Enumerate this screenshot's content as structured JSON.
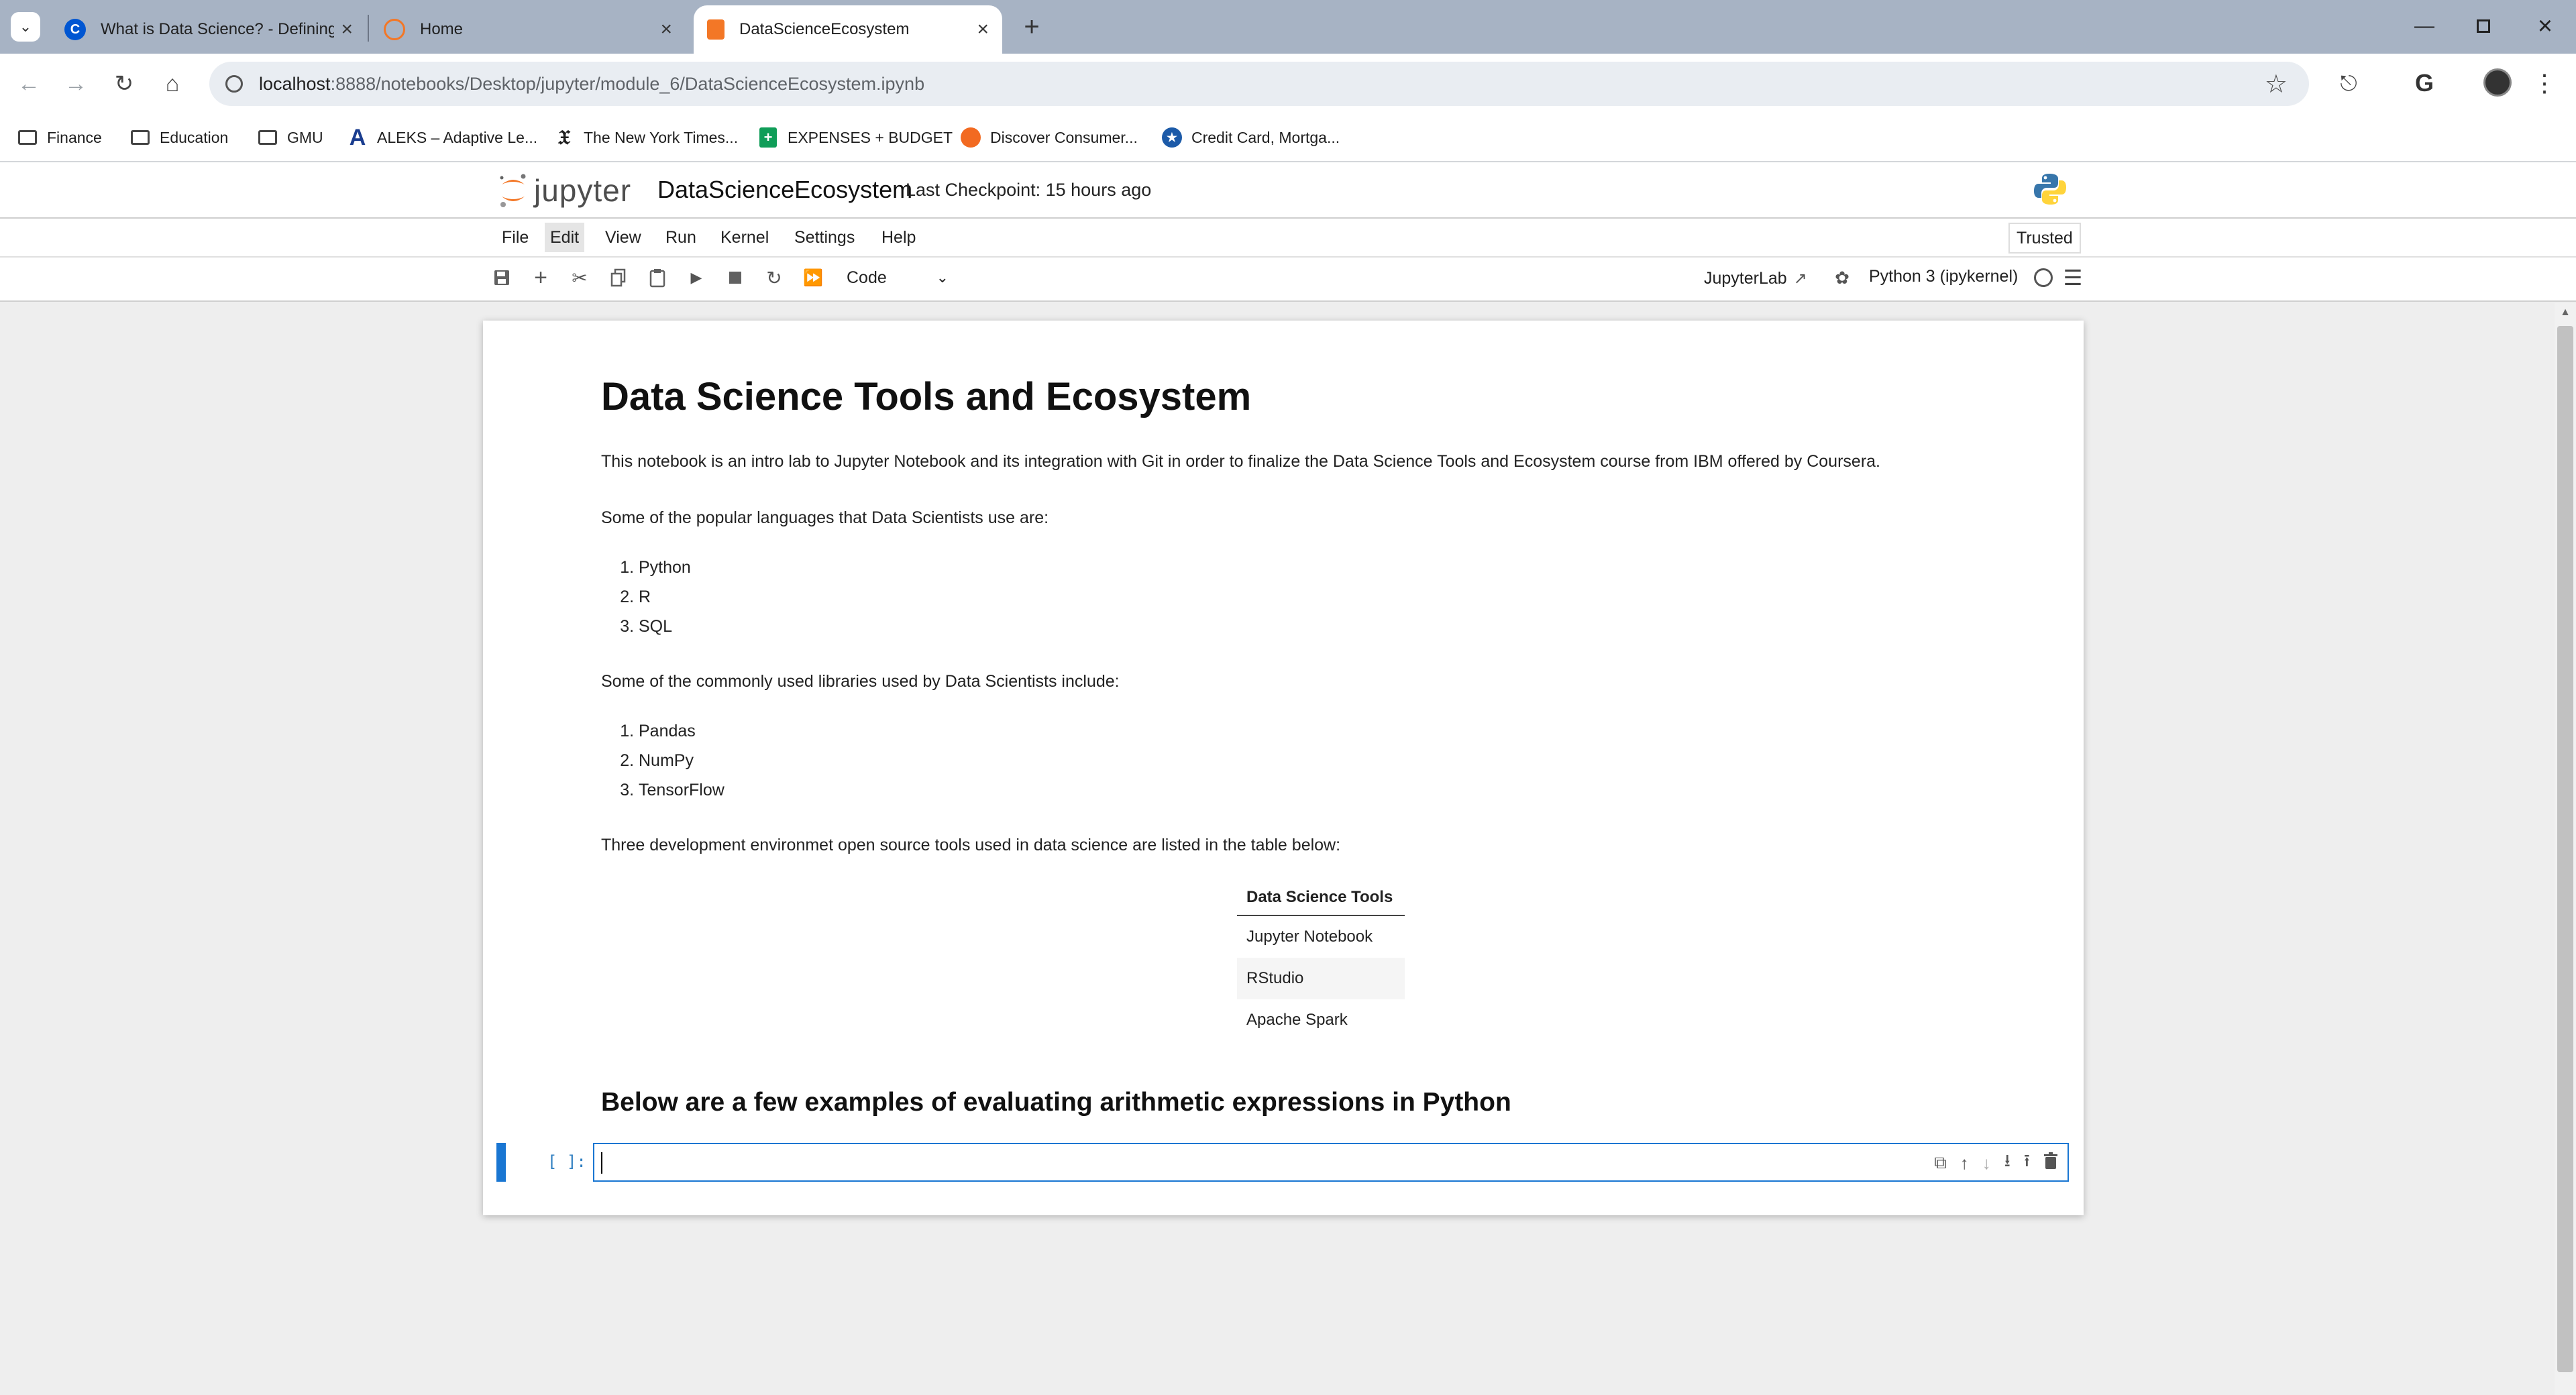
{
  "browser": {
    "tabs": [
      {
        "title": "What is Data Science? - Defining",
        "favicon": "coursera-icon",
        "active": false
      },
      {
        "title": "Home",
        "favicon": "jupyter-icon",
        "active": false
      },
      {
        "title": "DataScienceEcosystem",
        "favicon": "notebook-icon",
        "active": true
      }
    ],
    "url_host": "localhost",
    "url_path": ":8888/notebooks/Desktop/jupyter/module_6/DataScienceEcosystem.ipynb",
    "bookmarks": [
      {
        "label": "Finance",
        "icon": "folder-icon"
      },
      {
        "label": "Education",
        "icon": "folder-icon"
      },
      {
        "label": "GMU",
        "icon": "folder-icon"
      },
      {
        "label": "ALEKS – Adaptive Le...",
        "icon": "aleks-icon"
      },
      {
        "label": "The New York Times...",
        "icon": "nyt-icon"
      },
      {
        "label": "EXPENSES + BUDGET",
        "icon": "sheets-icon"
      },
      {
        "label": "Discover Consumer...",
        "icon": "discover-icon"
      },
      {
        "label": "Credit Card, Mortga...",
        "icon": "bank-icon"
      }
    ]
  },
  "jupyter": {
    "logo_text": "jupyter",
    "notebook_name": "DataScienceEcosystem",
    "checkpoint": "Last Checkpoint: 15 hours ago",
    "trusted": "Trusted",
    "menu": [
      "File",
      "Edit",
      "View",
      "Run",
      "Kernel",
      "Settings",
      "Help"
    ],
    "cell_type": "Code",
    "jupyterlab_link": "JupyterLab",
    "kernel": "Python 3 (ipykernel)"
  },
  "notebook": {
    "title": "Data Science Tools and Ecosystem",
    "intro": "This notebook is an intro lab to Jupyter Notebook and its integration with Git in order to finalize the Data Science Tools and Ecosystem course from IBM offered by Coursera.",
    "languages_intro": "Some of the popular languages that Data Scientists use are:",
    "languages": [
      "Python",
      "R",
      "SQL"
    ],
    "libraries_intro": "Some of the commonly used libraries used by Data Scientists include:",
    "libraries": [
      "Pandas",
      "NumPy",
      "TensorFlow"
    ],
    "tools_intro": "Three development environmet open source tools used in data science are listed in the table below:",
    "table_header": "Data Science Tools",
    "tools": [
      "Jupyter Notebook",
      "RStudio",
      "Apache Spark"
    ],
    "arith_heading": "Below are a few examples of evaluating arithmetic expressions in Python",
    "prompt": "[ ]:",
    "cell_value": ""
  }
}
